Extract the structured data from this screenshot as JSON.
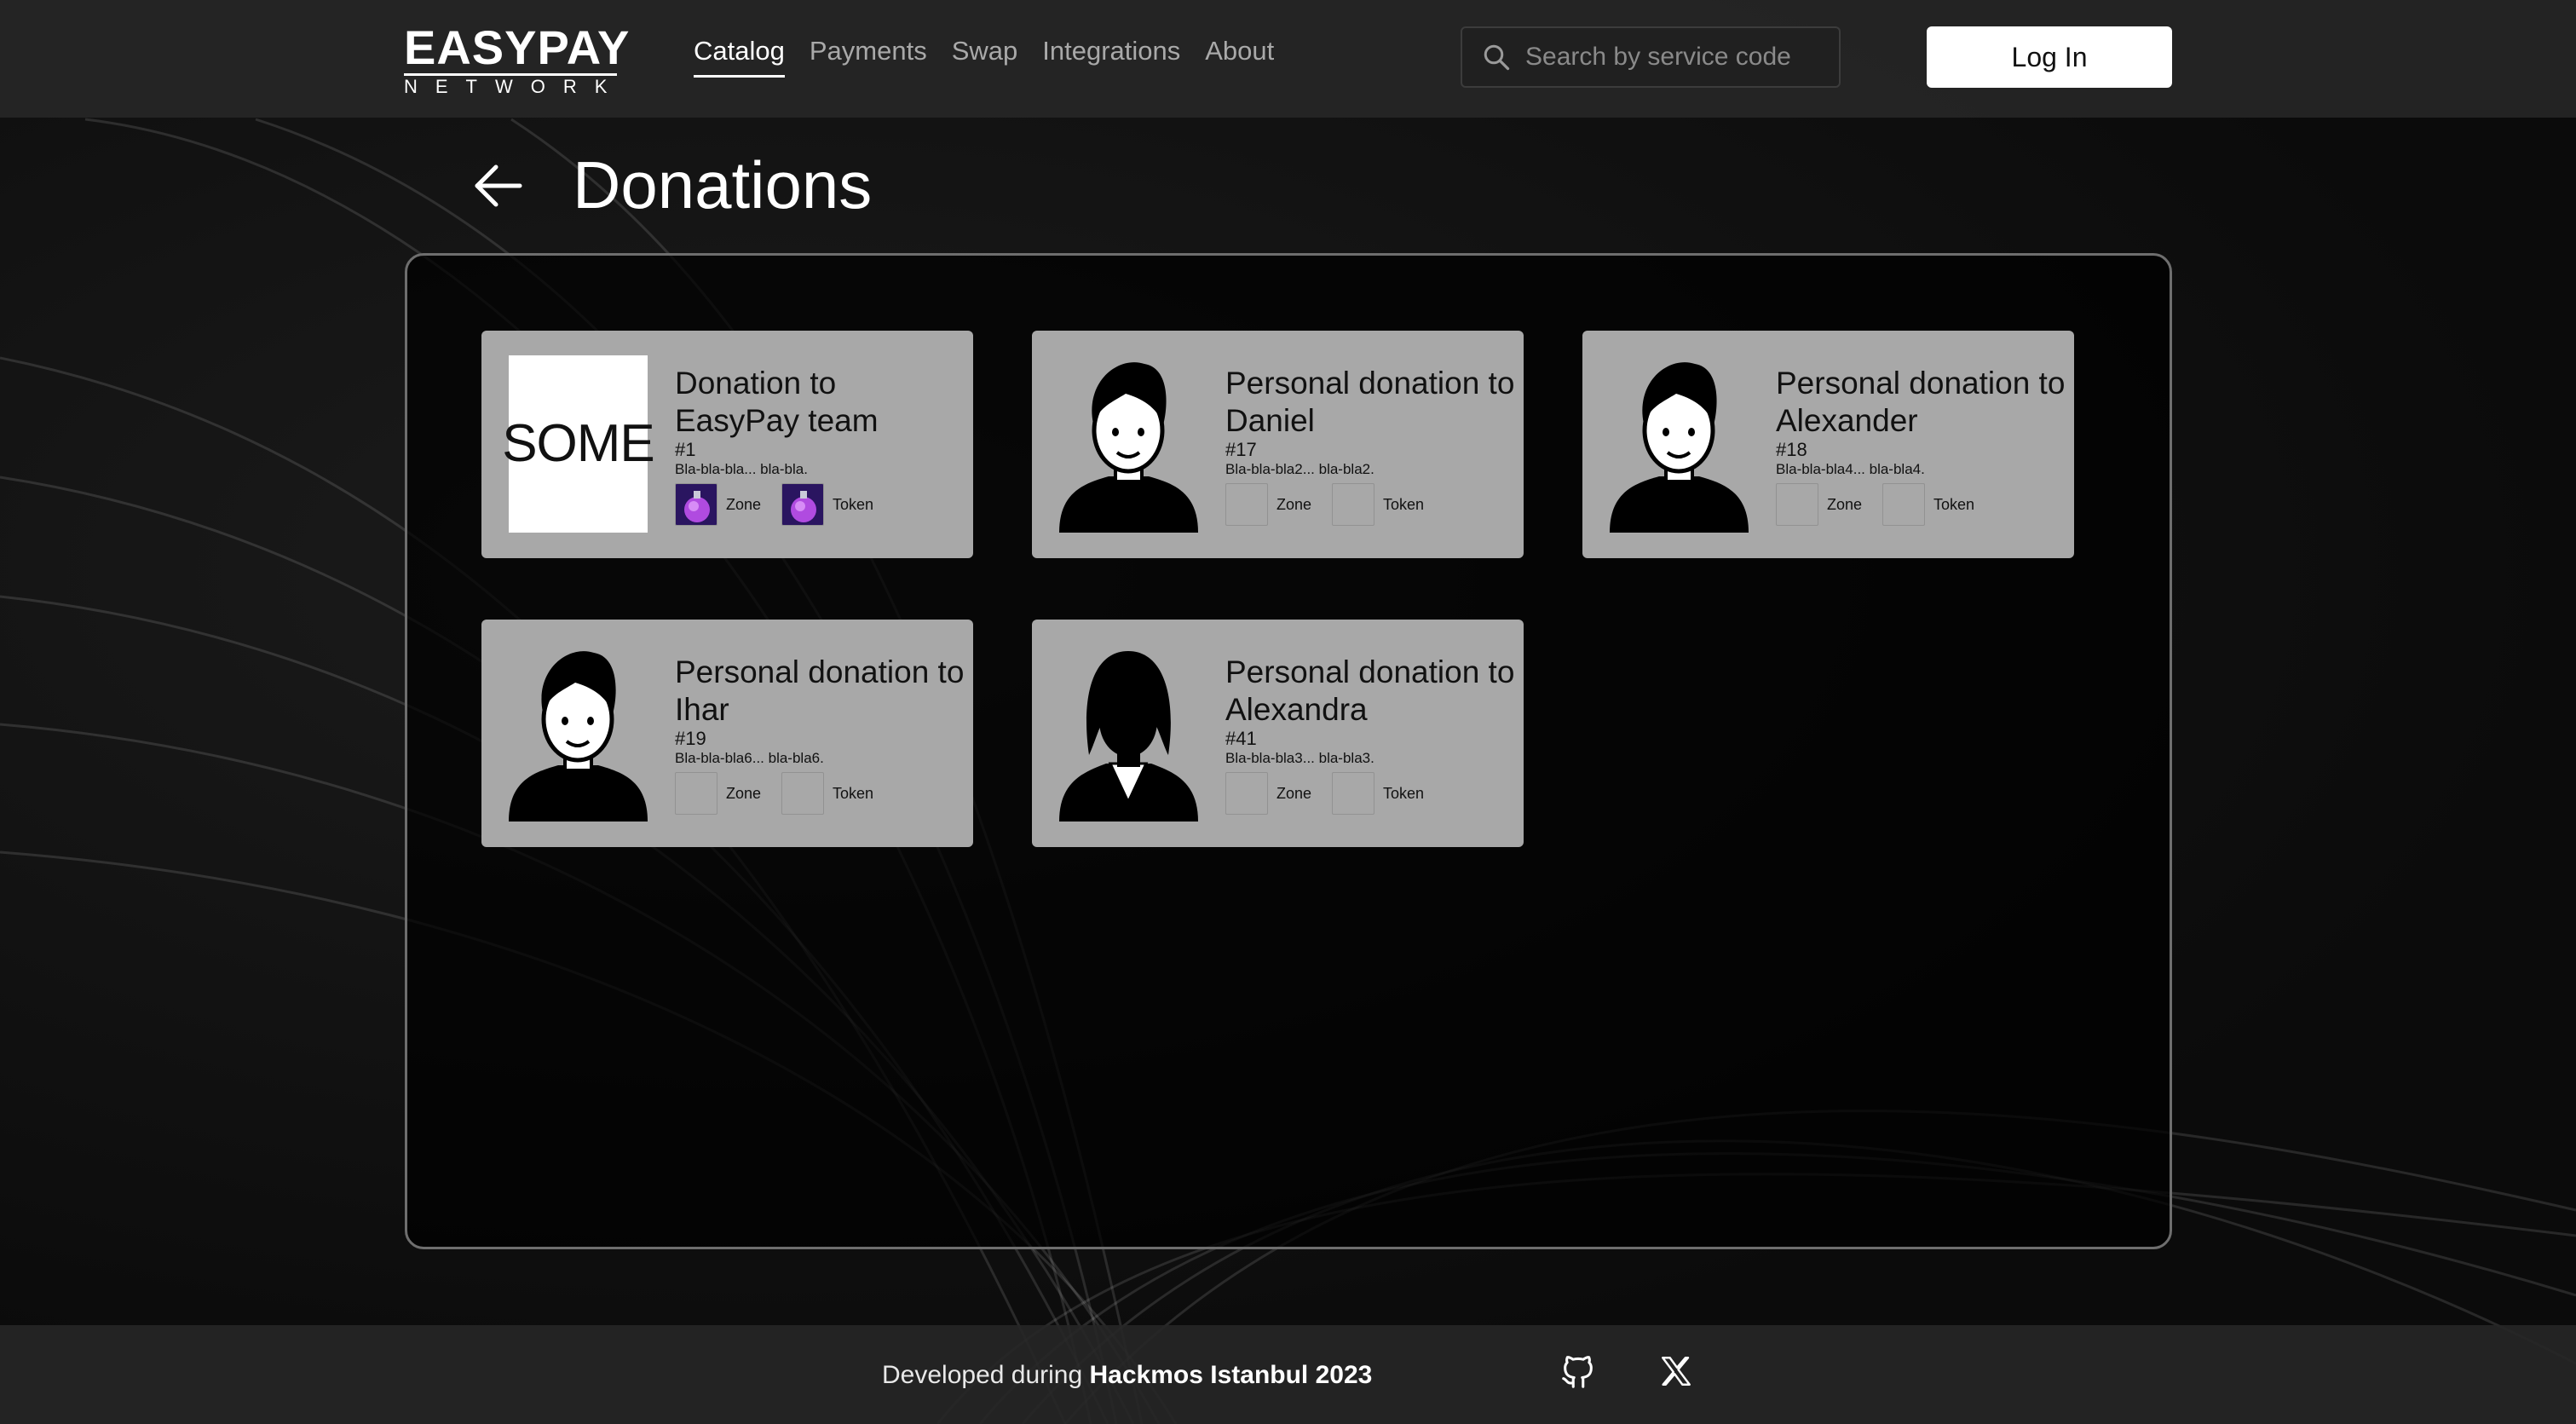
{
  "header": {
    "logo_main": "EASYPAY",
    "logo_sub": "NETWORK",
    "nav": [
      {
        "label": "Catalog",
        "active": true
      },
      {
        "label": "Payments",
        "active": false
      },
      {
        "label": "Swap",
        "active": false
      },
      {
        "label": "Integrations",
        "active": false
      },
      {
        "label": "About",
        "active": false
      }
    ],
    "search_placeholder": "Search by service code",
    "login_label": "Log In"
  },
  "page": {
    "title": "Donations"
  },
  "cards": [
    {
      "title": "Donation to EasyPay team",
      "id": "#1",
      "desc": "Bla-bla-bla... bla-bla.",
      "image": "some-logo",
      "image_text": "SOME",
      "zone_label": "Zone",
      "token_label": "Token",
      "chip_icons": "potion-icon"
    },
    {
      "title": "Personal donation to Daniel",
      "id": "#17",
      "desc": "Bla-bla-bla2... bla-bla2.",
      "image": "male-avatar",
      "zone_label": "Zone",
      "token_label": "Token",
      "chip_icons": "empty"
    },
    {
      "title": "Personal donation to Alexander",
      "id": "#18",
      "desc": "Bla-bla-bla4... bla-bla4.",
      "image": "male-avatar",
      "zone_label": "Zone",
      "token_label": "Token",
      "chip_icons": "empty"
    },
    {
      "title": "Personal donation to Ihar",
      "id": "#19",
      "desc": "Bla-bla-bla6... bla-bla6.",
      "image": "male-avatar",
      "zone_label": "Zone",
      "token_label": "Token",
      "chip_icons": "empty"
    },
    {
      "title": "Personal donation to Alexandra",
      "id": "#41",
      "desc": "Bla-bla-bla3... bla-bla3.",
      "image": "female-avatar",
      "zone_label": "Zone",
      "token_label": "Token",
      "chip_icons": "empty"
    }
  ],
  "footer": {
    "prefix": "Developed during ",
    "event": "Hackmos Istanbul 2023",
    "icons": [
      "github-icon",
      "x-icon"
    ]
  },
  "colors": {
    "background": "#111111",
    "card": "#a8a8a8",
    "accent": "#ffffff",
    "nav_inactive": "#a9a9a9"
  }
}
